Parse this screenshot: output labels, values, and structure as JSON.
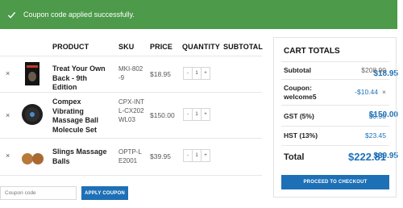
{
  "notice": {
    "message": "Coupon code applied successfully.",
    "icon": "check-icon"
  },
  "cart": {
    "headers": {
      "product": "PRODUCT",
      "sku": "SKU",
      "price": "PRICE",
      "quantity": "QUANTITY",
      "subtotal": "SUBTOTAL"
    },
    "remove_symbol": "×",
    "items": [
      {
        "name": "Treat Your Own Back - 9th Edition",
        "sku": "MKI-802-9",
        "price": "$18.95",
        "qty": "1",
        "subtotal": "$18.95"
      },
      {
        "name": "Compex Vibrating Massage Ball Molecule Set",
        "sku": "CPX-INTL-CX202WL03",
        "price": "$150.00",
        "qty": "1",
        "subtotal": "$150.00"
      },
      {
        "name": "Slings Massage Balls",
        "sku": "OPTP-LE2001",
        "price": "$39.95",
        "qty": "1",
        "subtotal": "$39.95"
      }
    ],
    "qty_minus": "-",
    "qty_plus": "+"
  },
  "coupon": {
    "placeholder": "Coupon code",
    "apply_label": "APPLY COUPON"
  },
  "totals": {
    "title": "CART TOTALS",
    "subtotal_label": "Subtotal",
    "subtotal_value": "$208.90",
    "coupon_label": "Coupon: welcome5",
    "coupon_value": "-$10.44",
    "coupon_remove": "×",
    "gst_label": "GST (5%)",
    "gst_value": "$0.90",
    "hst_label": "HST (13%)",
    "hst_value": "$23.45",
    "total_label": "Total",
    "total_value": "$222.81",
    "checkout_label": "PROCEED TO CHECKOUT"
  },
  "colors": {
    "accent": "#1e70b6",
    "notice_bg": "#4c9a4a"
  }
}
